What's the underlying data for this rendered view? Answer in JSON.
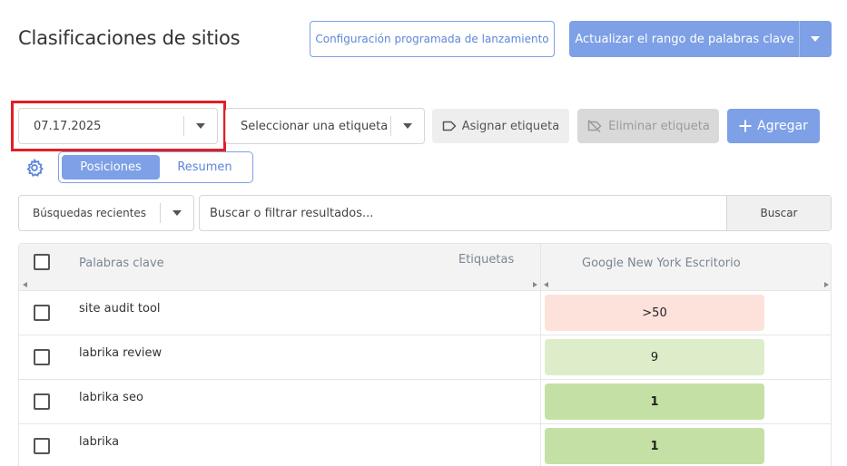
{
  "header": {
    "title": "Clasificaciones de sitios",
    "scheduled_launch_label": "Configuración programada de lanzamiento",
    "update_rank_label": "Actualizar el rango de palabras clave"
  },
  "toolbar": {
    "date_value": "07.17.2025",
    "tag_select_placeholder": "Seleccionar una etiqueta",
    "assign_tag_label": "Asignar etiqueta",
    "delete_tag_label": "Eliminar etiqueta",
    "add_label": "Agregar"
  },
  "view_tabs": {
    "positions": "Posiciones",
    "summary": "Resumen",
    "active": "positions"
  },
  "search": {
    "recent_label": "Búsquedas recientes",
    "placeholder": "Buscar o filtrar resultados...",
    "button_label": "Buscar"
  },
  "table": {
    "columns": {
      "keywords": "Palabras clave",
      "tags": "Etiquetas",
      "engine": "Google New York Escritorio"
    },
    "rows": [
      {
        "keyword": "site audit tool",
        "position": ">50",
        "color": "#fde2db"
      },
      {
        "keyword": "labrika review",
        "position": "9",
        "color": "#deedc9"
      },
      {
        "keyword": "labrika seo",
        "position": "1",
        "color": "#c5e0a5"
      },
      {
        "keyword": "labrika",
        "position": "1",
        "color": "#c5e0a5"
      }
    ]
  },
  "colors": {
    "accent": "#7da0e6",
    "highlight": "#e31e24"
  }
}
